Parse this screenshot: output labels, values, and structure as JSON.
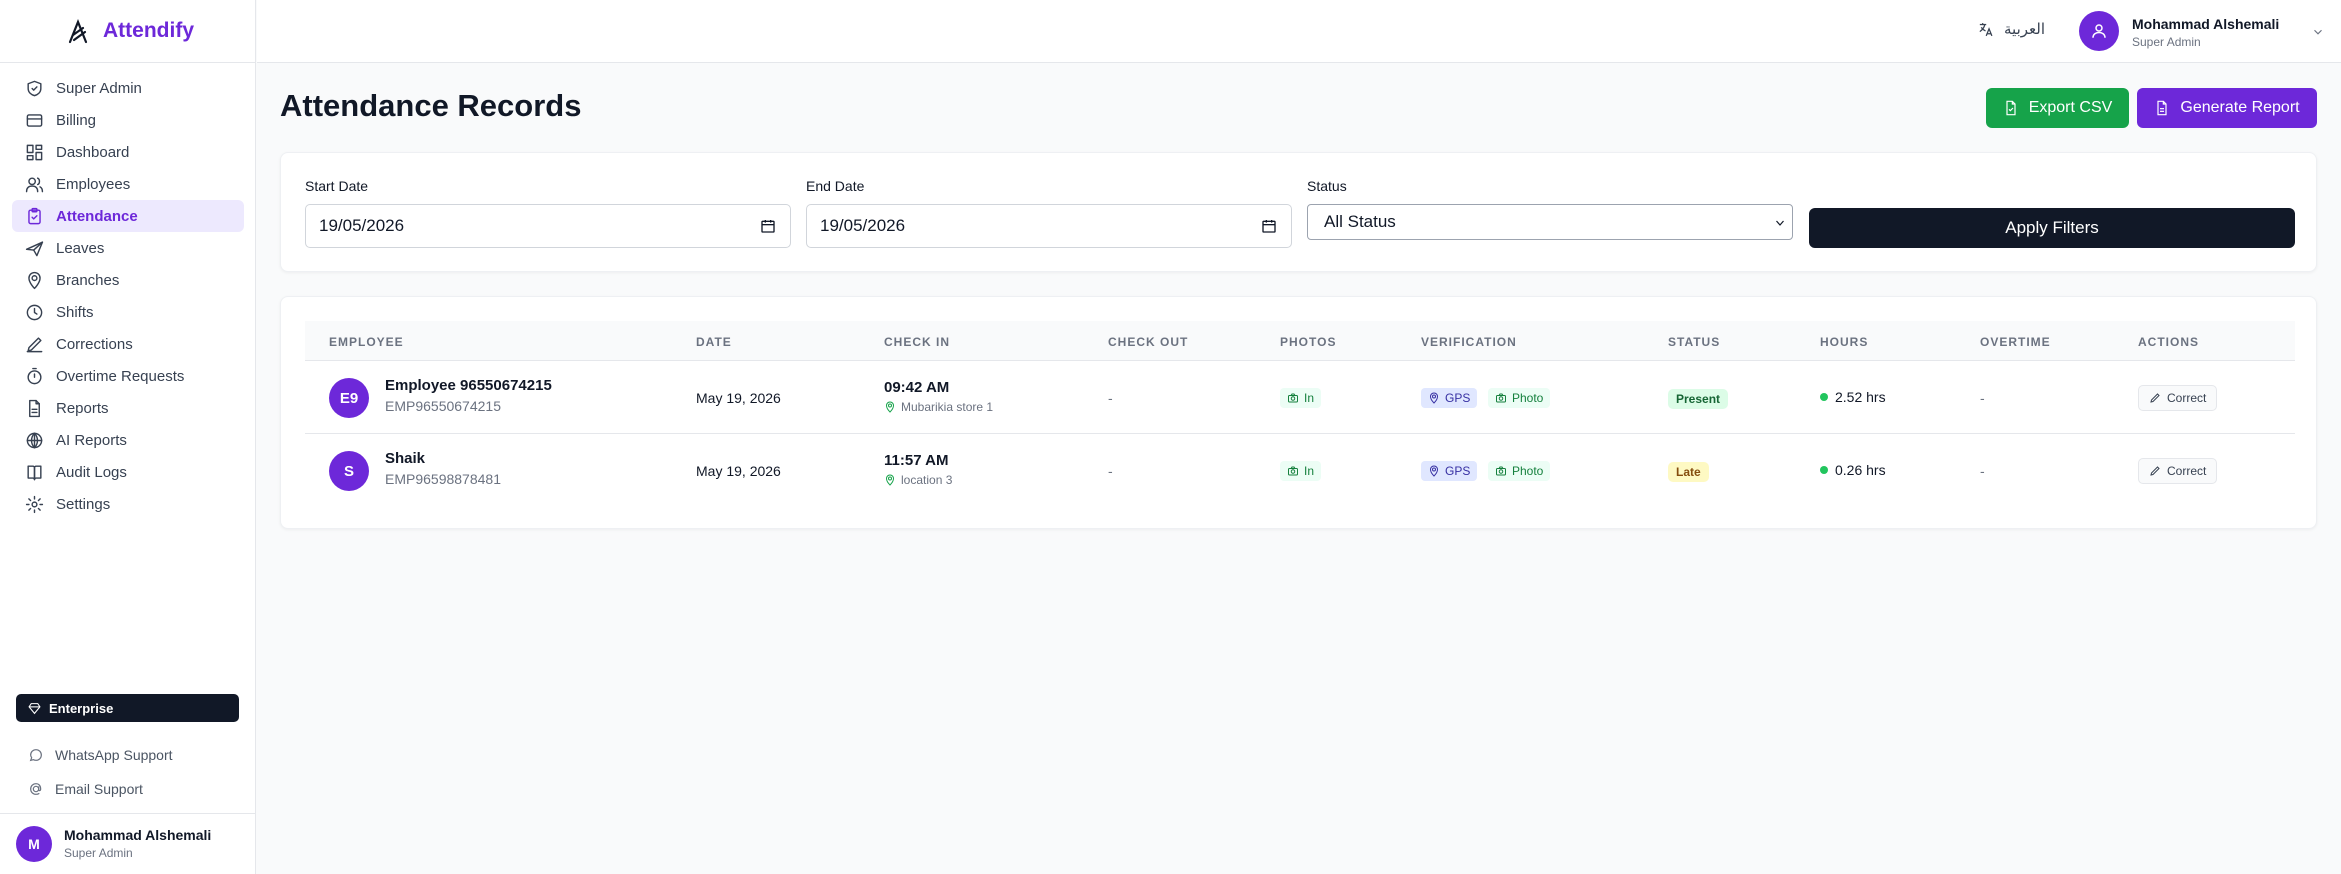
{
  "brand": {
    "name": "Attendify",
    "accent": "#6d28d9"
  },
  "sidebar": {
    "items": [
      {
        "label": "Super Admin",
        "icon": "shield-check-icon"
      },
      {
        "label": "Billing",
        "icon": "credit-card-icon"
      },
      {
        "label": "Dashboard",
        "icon": "dashboard-grid-icon"
      },
      {
        "label": "Employees",
        "icon": "users-icon"
      },
      {
        "label": "Attendance",
        "icon": "clipboard-check-icon",
        "active": true
      },
      {
        "label": "Leaves",
        "icon": "plane-icon"
      },
      {
        "label": "Branches",
        "icon": "map-pin-icon"
      },
      {
        "label": "Shifts",
        "icon": "clock-icon"
      },
      {
        "label": "Corrections",
        "icon": "pen-icon"
      },
      {
        "label": "Overtime Requests",
        "icon": "timer-icon"
      },
      {
        "label": "Reports",
        "icon": "file-text-icon"
      },
      {
        "label": "AI Reports",
        "icon": "brain-icon"
      },
      {
        "label": "Audit Logs",
        "icon": "book-icon"
      },
      {
        "label": "Settings",
        "icon": "gear-icon"
      }
    ],
    "plan": "Enterprise",
    "support": {
      "whatsapp": "WhatsApp Support",
      "email": "Email Support"
    },
    "user": {
      "initial": "M",
      "name": "Mohammad Alshemali",
      "role": "Super Admin"
    }
  },
  "header": {
    "language": "العربية",
    "user": {
      "name": "Mohammad Alshemali",
      "role": "Super Admin"
    }
  },
  "page": {
    "title": "Attendance Records",
    "export_label": "Export CSV",
    "generate_label": "Generate Report"
  },
  "filters": {
    "start_label": "Start Date",
    "start_value": "19/05/2026",
    "end_label": "End Date",
    "end_value": "19/05/2026",
    "status_label": "Status",
    "status_value": "All Status",
    "apply_label": "Apply Filters"
  },
  "table": {
    "headers": {
      "employee": "EMPLOYEE",
      "date": "DATE",
      "check_in": "CHECK IN",
      "check_out": "CHECK OUT",
      "photos": "PHOTOS",
      "verification": "VERIFICATION",
      "status": "STATUS",
      "hours": "HOURS",
      "overtime": "OVERTIME",
      "actions": "ACTIONS"
    },
    "rows": [
      {
        "initials": "E9",
        "name": "Employee 96550674215",
        "emp_id": "EMP96550674215",
        "date": "May 19, 2026",
        "check_in_time": "09:42 AM",
        "check_in_location": "Mubarikia store 1",
        "check_out": "-",
        "photos": "In",
        "verify_gps": "GPS",
        "verify_photo": "Photo",
        "status": "Present",
        "hours": "2.52 hrs",
        "overtime": "-",
        "action": "Correct"
      },
      {
        "initials": "S",
        "name": "Shaik",
        "emp_id": "EMP96598878481",
        "date": "May 19, 2026",
        "check_in_time": "11:57 AM",
        "check_in_location": "location 3",
        "check_out": "-",
        "photos": "In",
        "verify_gps": "GPS",
        "verify_photo": "Photo",
        "status": "Late",
        "hours": "0.26 hrs",
        "overtime": "-",
        "action": "Correct"
      }
    ]
  }
}
